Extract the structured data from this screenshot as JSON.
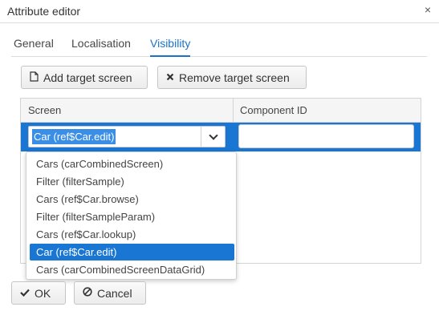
{
  "window": {
    "title": "Attribute editor",
    "close_glyph": "×"
  },
  "tabs": [
    {
      "label": "General"
    },
    {
      "label": "Localisation"
    },
    {
      "label": "Visibility"
    }
  ],
  "active_tab": "Visibility",
  "toolbar": {
    "add_label": "Add target screen",
    "add_icon": "document-icon",
    "remove_label": "Remove target screen",
    "remove_icon": "x-icon"
  },
  "table": {
    "columns": [
      "Screen",
      "Component ID"
    ],
    "row": {
      "screen": "Car (ref$Car.edit)",
      "component_id": ""
    }
  },
  "dropdown": {
    "options": [
      "Cars (carCombinedScreen)",
      "Filter (filterSample)",
      "Cars (ref$Car.browse)",
      "Filter (filterSampleParam)",
      "Cars (ref$Car.lookup)",
      "Car (ref$Car.edit)",
      "Cars (carCombinedScreenDataGrid)"
    ],
    "selected": "Car (ref$Car.edit)"
  },
  "footer": {
    "ok_label": "OK",
    "ok_icon": "check-icon",
    "cancel_label": "Cancel",
    "cancel_icon": "ban-icon"
  },
  "colors": {
    "accent": "#1976d2",
    "active_tab": "#1a73c9"
  }
}
